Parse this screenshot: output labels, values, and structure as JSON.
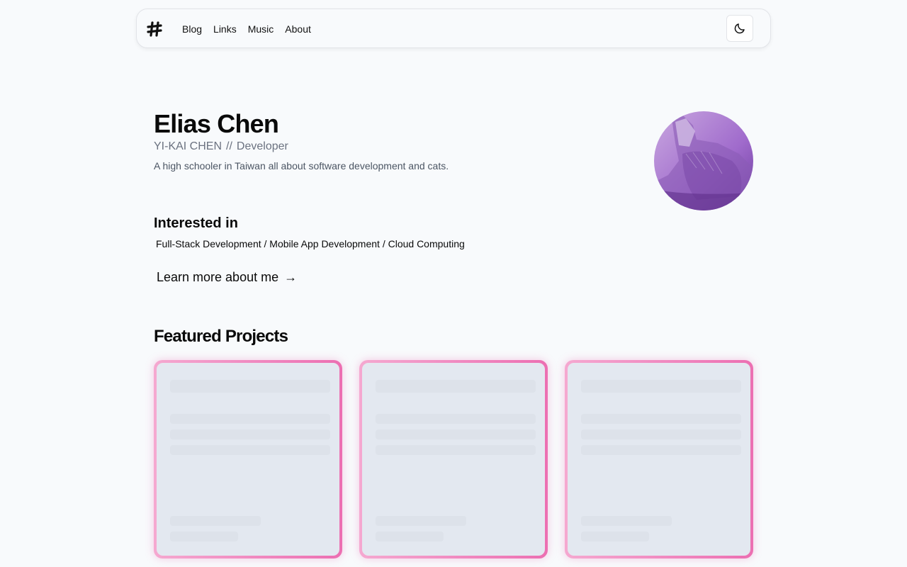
{
  "nav": {
    "logo_icon": "hashtag-icon",
    "links": [
      "Blog",
      "Links",
      "Music",
      "About"
    ],
    "theme_toggle_icon": "moon-icon"
  },
  "hero": {
    "name": "Elias Chen",
    "romanized_name": "YI-KAI CHEN",
    "separator": "//",
    "role": "Developer",
    "description": "A high schooler in Taiwan all about software development and cats.",
    "avatar_alt": "cat photo avatar"
  },
  "interests": {
    "title": "Interested in",
    "list": "Full-Stack Development / Mobile App Development / Cloud Computing"
  },
  "learn_more": {
    "label": "Learn more about me",
    "arrow": "→"
  },
  "projects": {
    "title": "Featured Projects",
    "cards": [
      {
        "state": "loading"
      },
      {
        "state": "loading"
      },
      {
        "state": "loading"
      }
    ]
  },
  "colors": {
    "card_border_start": "#f5a8d0",
    "card_border_end": "#ec6fb2",
    "skeleton": "#dde2ea",
    "avatar_tint": "#8e44ad"
  }
}
